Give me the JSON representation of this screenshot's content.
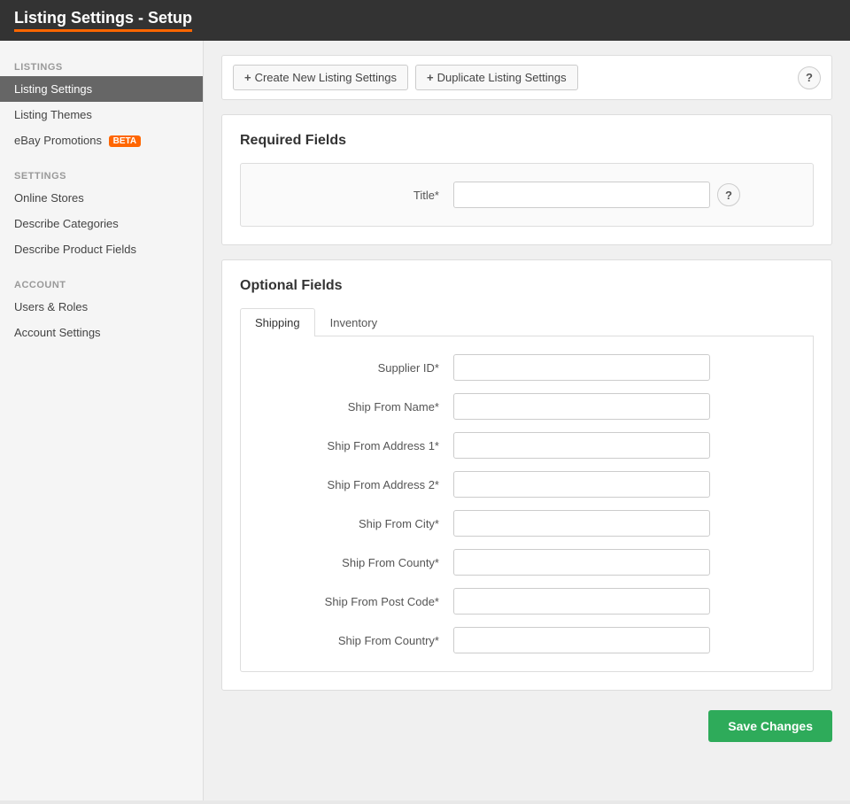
{
  "header": {
    "title": "Listing Settings - Setup"
  },
  "toolbar": {
    "create_label": "Create New Listing Settings",
    "duplicate_label": "Duplicate Listing Settings",
    "help_icon": "?"
  },
  "sidebar": {
    "listings_section_label": "LISTINGS",
    "items_listings": [
      {
        "id": "listing-settings",
        "label": "Listing Settings",
        "active": true
      },
      {
        "id": "listing-themes",
        "label": "Listing Themes",
        "active": false
      },
      {
        "id": "ebay-promotions",
        "label": "eBay Promotions",
        "active": false,
        "badge": "BETA"
      }
    ],
    "settings_section_label": "SETTINGS",
    "items_settings": [
      {
        "id": "online-stores",
        "label": "Online Stores",
        "active": false
      },
      {
        "id": "describe-categories",
        "label": "Describe Categories",
        "active": false
      },
      {
        "id": "describe-product-fields",
        "label": "Describe Product Fields",
        "active": false
      }
    ],
    "account_section_label": "ACCOUNT",
    "items_account": [
      {
        "id": "users-roles",
        "label": "Users & Roles",
        "active": false
      },
      {
        "id": "account-settings",
        "label": "Account Settings",
        "active": false
      }
    ]
  },
  "required_fields": {
    "section_title": "Required Fields",
    "fields": [
      {
        "id": "title",
        "label": "Title*",
        "placeholder": "",
        "value": "",
        "has_help": true
      }
    ]
  },
  "optional_fields": {
    "section_title": "Optional Fields",
    "tabs": [
      {
        "id": "shipping",
        "label": "Shipping",
        "active": true
      },
      {
        "id": "inventory",
        "label": "Inventory",
        "active": false
      }
    ],
    "shipping_fields": [
      {
        "id": "supplier-id",
        "label": "Supplier ID*",
        "placeholder": "",
        "value": ""
      },
      {
        "id": "ship-from-name",
        "label": "Ship From Name*",
        "placeholder": "",
        "value": ""
      },
      {
        "id": "ship-from-address-1",
        "label": "Ship From Address 1*",
        "placeholder": "",
        "value": ""
      },
      {
        "id": "ship-from-address-2",
        "label": "Ship From Address 2*",
        "placeholder": "",
        "value": ""
      },
      {
        "id": "ship-from-city",
        "label": "Ship From City*",
        "placeholder": "",
        "value": ""
      },
      {
        "id": "ship-from-county",
        "label": "Ship From County*",
        "placeholder": "",
        "value": ""
      },
      {
        "id": "ship-from-post-code",
        "label": "Ship From Post Code*",
        "placeholder": "",
        "value": ""
      },
      {
        "id": "ship-from-country",
        "label": "Ship From Country*",
        "placeholder": "",
        "value": ""
      }
    ]
  },
  "footer": {
    "save_label": "Save Changes"
  }
}
